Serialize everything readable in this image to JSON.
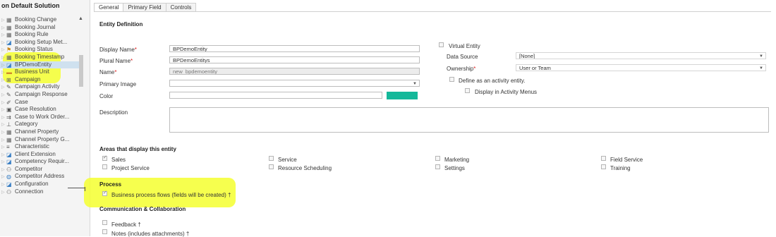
{
  "sidebar": {
    "title": "on Default Solution",
    "items": [
      {
        "label": "Booking Change",
        "icon": "grid-icon",
        "color": "#666"
      },
      {
        "label": "Booking Journal",
        "icon": "grid-icon",
        "color": "#666"
      },
      {
        "label": "Booking Rule",
        "icon": "grid-icon",
        "color": "#666"
      },
      {
        "label": "Booking Setup Met...",
        "icon": "person-doc-icon",
        "color": "#3a7fc4"
      },
      {
        "label": "Booking Status",
        "icon": "flag-icon",
        "color": "#c88a20"
      },
      {
        "label": "Booking Timestamp",
        "icon": "grid-icon",
        "color": "#666"
      },
      {
        "label": "BPDemoEntity",
        "icon": "person-doc-icon",
        "color": "#3a7fc4"
      },
      {
        "label": "Business Unit",
        "icon": "briefcase-icon",
        "color": "#d08a2a"
      },
      {
        "label": "Campaign",
        "icon": "campaign-icon",
        "color": "#555"
      },
      {
        "label": "Campaign Activity",
        "icon": "megaphone-icon",
        "color": "#555"
      },
      {
        "label": "Campaign Response",
        "icon": "megaphone-icon",
        "color": "#555"
      },
      {
        "label": "Case",
        "icon": "wrench-icon",
        "color": "#555"
      },
      {
        "label": "Case Resolution",
        "icon": "case-doc-icon",
        "color": "#555"
      },
      {
        "label": "Case to Work Order...",
        "icon": "case-arrow-icon",
        "color": "#555"
      },
      {
        "label": "Category",
        "icon": "hierarchy-icon",
        "color": "#555"
      },
      {
        "label": "Channel Property",
        "icon": "grid-icon",
        "color": "#666"
      },
      {
        "label": "Channel Property G...",
        "icon": "grid-icon",
        "color": "#666"
      },
      {
        "label": "Characteristic",
        "icon": "person-bars-icon",
        "color": "#555"
      },
      {
        "label": "Client Extension",
        "icon": "person-doc-icon",
        "color": "#3a7fc4"
      },
      {
        "label": "Competency Requir...",
        "icon": "person-doc-icon",
        "color": "#3a7fc4"
      },
      {
        "label": "Competitor",
        "icon": "people-icon",
        "color": "#555"
      },
      {
        "label": "Competitor Address",
        "icon": "globe-icon",
        "color": "#3a7fc4"
      },
      {
        "label": "Configuration",
        "icon": "person-doc-icon",
        "color": "#3a7fc4"
      },
      {
        "label": "Connection",
        "icon": "people-icon",
        "color": "#555"
      }
    ]
  },
  "tabs": [
    {
      "label": "General",
      "active": true
    },
    {
      "label": "Primary Field",
      "active": false
    },
    {
      "label": "Controls",
      "active": false
    }
  ],
  "entity_definition": {
    "heading": "Entity Definition",
    "display_name": {
      "label": "Display Name",
      "value": "BPDemoEntity"
    },
    "plural_name": {
      "label": "Plural Name",
      "value": "BPDemoEntitys"
    },
    "name": {
      "label": "Name",
      "value": "new_bpdemoentity"
    },
    "primary_image": {
      "label": "Primary Image",
      "value": ""
    },
    "color": {
      "label": "Color",
      "value": "",
      "swatch": "#14b89a"
    },
    "description": {
      "label": "Description",
      "value": ""
    },
    "virtual_entity": "Virtual Entity",
    "data_source": {
      "label": "Data Source",
      "value": "[None]"
    },
    "ownership": {
      "label": "Ownership",
      "value": "User or Team"
    },
    "define_activity": "Define as an activity entity.",
    "display_activity_menus": "Display in Activity Menus"
  },
  "areas": {
    "heading": "Areas that display this entity",
    "items": [
      {
        "label": "Sales",
        "checked": true
      },
      {
        "label": "Service",
        "checked": false
      },
      {
        "label": "Marketing",
        "checked": false
      },
      {
        "label": "Field Service",
        "checked": false
      },
      {
        "label": "Project Service",
        "checked": false
      },
      {
        "label": "Resource Scheduling",
        "checked": false
      },
      {
        "label": "Settings",
        "checked": false
      },
      {
        "label": "Training",
        "checked": false
      }
    ]
  },
  "process": {
    "heading": "Process",
    "bpf_label": "Business process flows (fields will be created)",
    "bpf_checked": true
  },
  "communication": {
    "heading": "Communication & Collaboration",
    "feedback": "Feedback",
    "notes": "Notes (includes attachments)"
  },
  "symbols": {
    "required": "*",
    "dagger": "†"
  },
  "highlight_color": "#f4ff2f"
}
